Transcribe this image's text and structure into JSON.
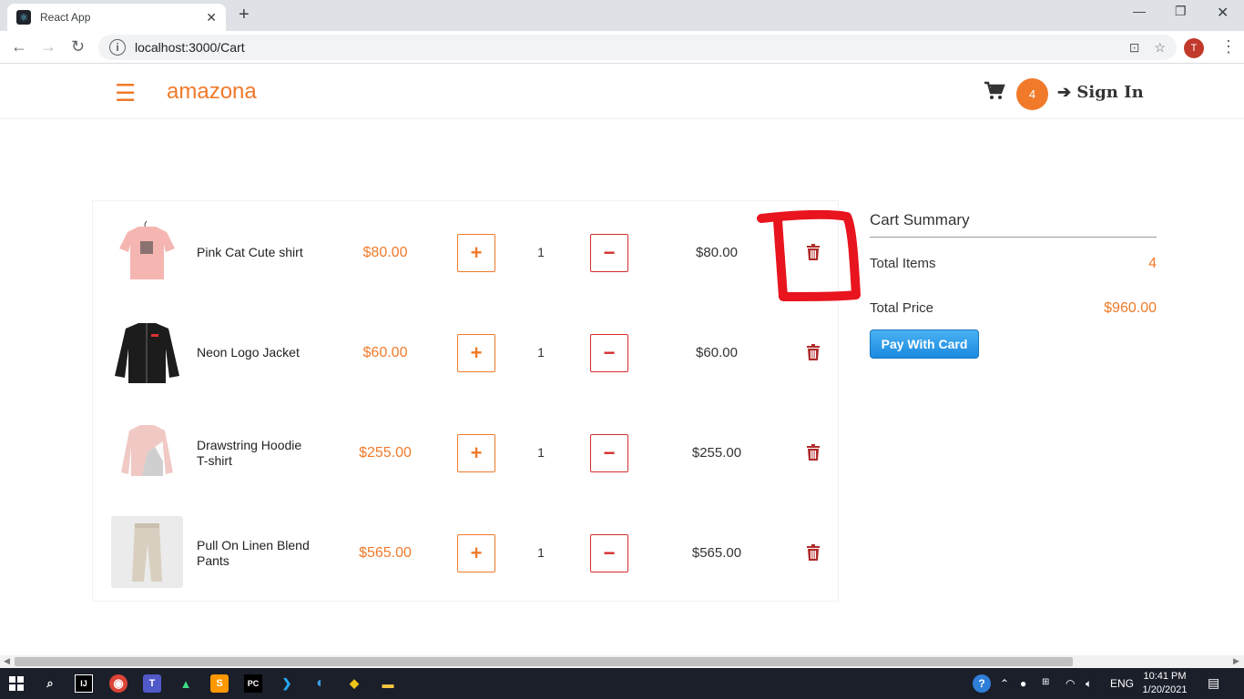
{
  "browser": {
    "tab_title": "React App",
    "url": "localhost:3000/Cart",
    "profile_initial": "T"
  },
  "header": {
    "brand": "amazona",
    "cart_count": "4",
    "sign_in_label": "Sign In"
  },
  "cart": {
    "items": [
      {
        "name": "Pink Cat Cute shirt",
        "price": "$80.00",
        "qty": "1",
        "subtotal": "$80.00",
        "image": "pink-shirt"
      },
      {
        "name": "Neon Logo Jacket",
        "price": "$60.00",
        "qty": "1",
        "subtotal": "$60.00",
        "image": "black-jacket"
      },
      {
        "name": "Drawstring Hoodie T-shirt",
        "price": "$255.00",
        "qty": "1",
        "subtotal": "$255.00",
        "image": "hoodie"
      },
      {
        "name": "Pull On Linen Blend Pants",
        "price": "$565.00",
        "qty": "1",
        "subtotal": "$565.00",
        "image": "pants"
      }
    ],
    "plus_symbol": "+",
    "minus_symbol": "−"
  },
  "summary": {
    "title": "Cart Summary",
    "total_items_label": "Total Items",
    "total_items_value": "4",
    "total_price_label": "Total Price",
    "total_price_value": "$960.00",
    "pay_button_label": "Pay With Card"
  },
  "taskbar": {
    "language": "ENG",
    "time": "10:41 PM",
    "date": "1/20/2021"
  },
  "colors": {
    "accent": "#f07a2a",
    "danger": "#d42d2d",
    "annotation": "#e8141e"
  }
}
